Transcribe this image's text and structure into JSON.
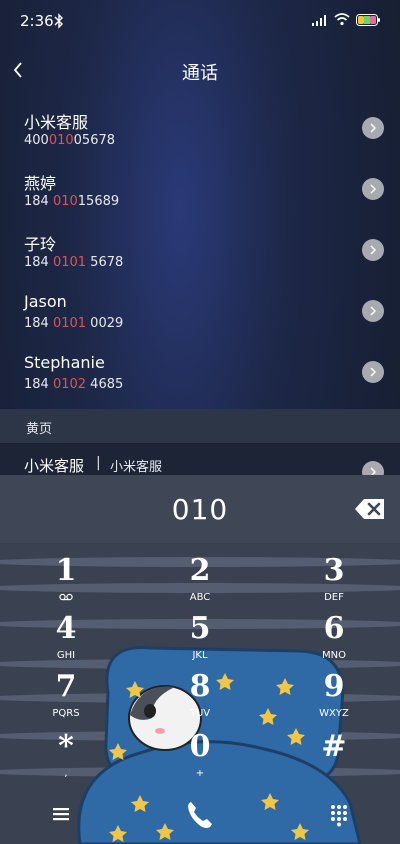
{
  "status_bar": {
    "time": "2:36"
  },
  "header": {
    "title": "通话"
  },
  "contacts": [
    {
      "name": "小米客服",
      "number_pre": "400",
      "number_hl": "010",
      "number_post": "05678"
    },
    {
      "name": "燕婷",
      "number_pre": "184 ",
      "number_hl": "010",
      "number_post": "15689"
    },
    {
      "name": "子玲",
      "number_pre": "184 ",
      "number_hl": "0101",
      "number_post": " 5678"
    },
    {
      "name": "Jason",
      "number_pre": "184 ",
      "number_hl": "0101",
      "number_post": " 0029"
    },
    {
      "name": "Stephanie",
      "number_pre": "184 ",
      "number_hl": "0102",
      "number_post": " 4685"
    }
  ],
  "yellow_pages": {
    "label": "黄页",
    "entry_name": "小米客服",
    "separator": "|",
    "entry_sub": "小米客服"
  },
  "dial": {
    "value": "010"
  },
  "keypad": {
    "keys": [
      {
        "digit": "1",
        "letters": ""
      },
      {
        "digit": "2",
        "letters": "ABC"
      },
      {
        "digit": "3",
        "letters": "DEF"
      },
      {
        "digit": "4",
        "letters": "GHI"
      },
      {
        "digit": "5",
        "letters": "JKL"
      },
      {
        "digit": "6",
        "letters": "MNO"
      },
      {
        "digit": "7",
        "letters": "PQRS"
      },
      {
        "digit": "8",
        "letters": "TUV"
      },
      {
        "digit": "9",
        "letters": "WXYZ"
      },
      {
        "digit": "*",
        "letters": ","
      },
      {
        "digit": "0",
        "letters": "+"
      },
      {
        "digit": "#",
        "letters": ""
      }
    ]
  },
  "colors": {
    "highlight": "#e0525a",
    "detail_button": "#a8aab0",
    "keypad_bg": "#3a4150"
  },
  "icons": {
    "back": "chevron-left-icon",
    "backspace": "backspace-icon",
    "menu": "menu-icon",
    "call": "phone-icon",
    "dialpad": "dialpad-icon",
    "voicemail": "voicemail-icon"
  }
}
